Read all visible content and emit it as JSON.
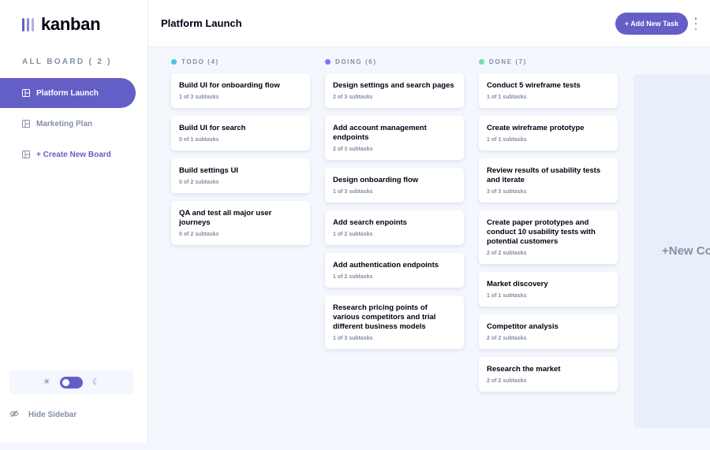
{
  "app": {
    "logo_text": "kanban"
  },
  "sidebar": {
    "heading": "ALL BOARD ( 2 )",
    "boards": [
      {
        "label": "Platform Launch",
        "active": true
      },
      {
        "label": "Marketing Plan",
        "active": false
      }
    ],
    "create_label": "+ Create New Board",
    "hide_label": "Hide Sidebar"
  },
  "header": {
    "title": "Platform Launch",
    "add_task_label": "+ Add New Task"
  },
  "columns": [
    {
      "name": "TODO (4)",
      "color": "#49c4e5",
      "tasks": [
        {
          "title": "Build UI for onboarding flow",
          "subtasks": "1 of 3 subtasks"
        },
        {
          "title": "Build UI for search",
          "subtasks": "0 of 1 subtasks"
        },
        {
          "title": "Build settings UI",
          "subtasks": "0 of 2 subtasks"
        },
        {
          "title": "QA and test all major user journeys",
          "subtasks": "0 of 2 subtasks"
        }
      ]
    },
    {
      "name": "DOING (6)",
      "color": "#8471f2",
      "tasks": [
        {
          "title": "Design settings and search pages",
          "subtasks": "2 of 3 subtasks"
        },
        {
          "title": "Add account management endpoints",
          "subtasks": "2 of 3 subtasks"
        },
        {
          "title": "Design onboarding flow",
          "subtasks": "1 of 3 subtasks"
        },
        {
          "title": "Add search enpoints",
          "subtasks": "1 of 2 subtasks"
        },
        {
          "title": "Add authentication endpoints",
          "subtasks": "1 of 2 subtasks"
        },
        {
          "title": "Research pricing points of various competitors and trial different business models",
          "subtasks": "1 of 3 subtasks"
        }
      ]
    },
    {
      "name": "DONE (7)",
      "color": "#67e2ae",
      "tasks": [
        {
          "title": "Conduct 5 wireframe tests",
          "subtasks": "1 of 1 subtasks"
        },
        {
          "title": "Create wireframe prototype",
          "subtasks": "1 of 1 subtasks"
        },
        {
          "title": "Review results of usability tests and iterate",
          "subtasks": "3 of 3 subtasks"
        },
        {
          "title": "Create paper prototypes and conduct 10 usability tests with potential customers",
          "subtasks": "2 of 2 subtasks"
        },
        {
          "title": "Market discovery",
          "subtasks": "1 of 1 subtasks"
        },
        {
          "title": "Competitor analysis",
          "subtasks": "2 of 2 subtasks"
        },
        {
          "title": "Research the market",
          "subtasks": "2 of 2 subtasks"
        }
      ]
    }
  ],
  "new_column_label": "+New Column",
  "colors": {
    "accent": "#635fc7"
  }
}
